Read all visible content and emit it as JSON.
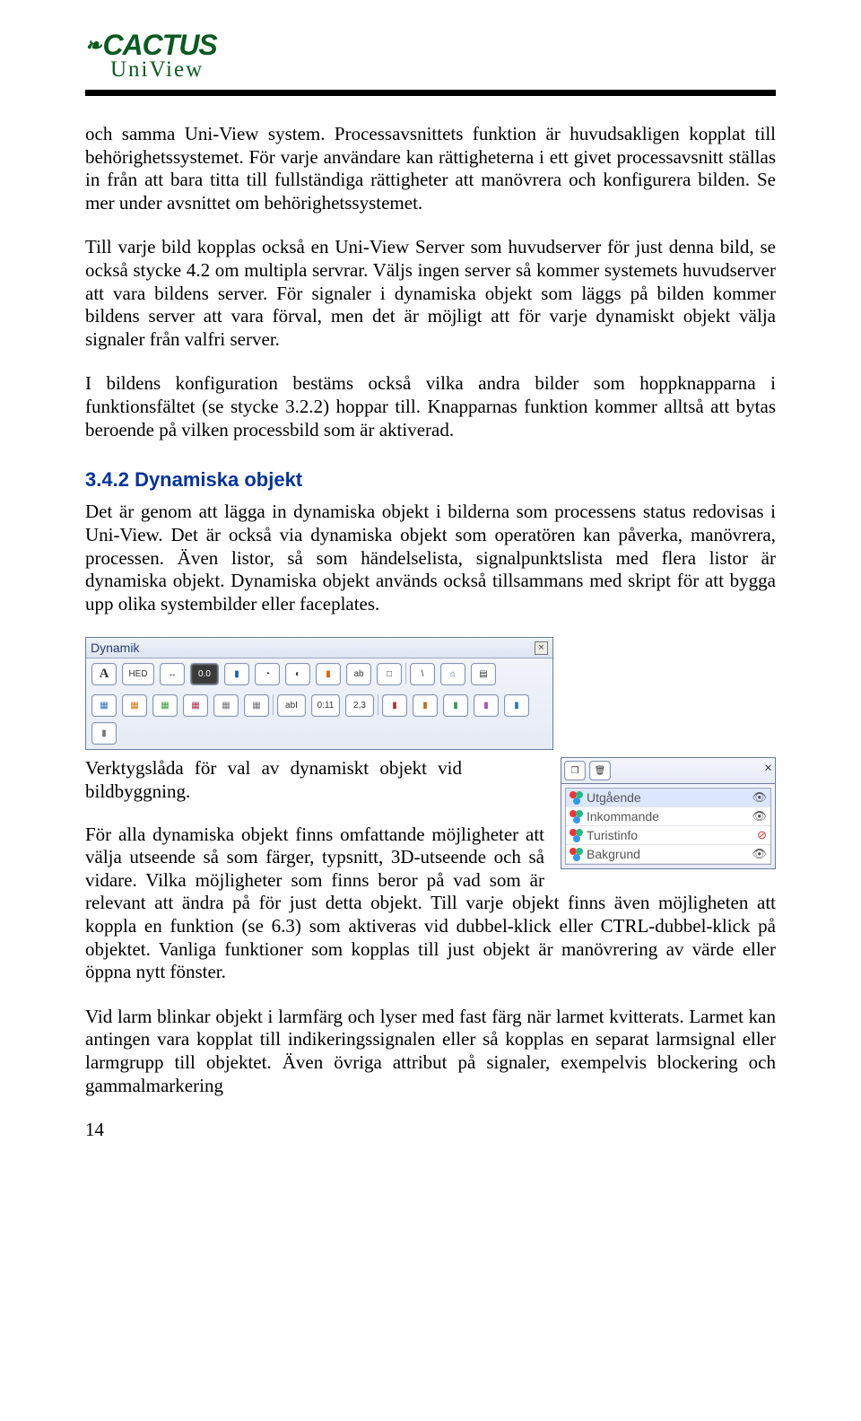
{
  "brand": {
    "line1": "CACTUS",
    "line2": "UniView"
  },
  "paragraphs": {
    "p1": "och samma Uni-View system. Processavsnittets funktion är huvudsakligen kopplat till behörighetssystemet. För varje användare kan rättigheterna i ett givet processavsnitt ställas in från att bara titta till fullständiga rättigheter att manövrera och konfigurera bilden. Se mer under avsnittet om behörighetssystemet.",
    "p2": "Till varje bild kopplas också en Uni-View Server som huvudserver för just denna bild, se också stycke 4.2 om multipla servrar. Väljs ingen server så kommer systemets huvudserver att vara bildens server. För signaler i dynamiska objekt som läggs på bilden kommer bildens server att vara förval, men det är möjligt att för varje dynamiskt objekt välja signaler från valfri server.",
    "p3": "I bildens konfiguration bestäms också vilka andra bilder som hoppknapparna i funktionsfältet (se stycke 3.2.2) hoppar till. Knapparnas funktion kommer alltså att bytas beroende på vilken processbild som är aktiverad.",
    "p4": "Det är genom att lägga in dynamiska objekt i bilderna som processens status redovisas i Uni-View. Det är också via dynamiska objekt som operatören kan påverka, manövrera, processen. Även listor, så som händelselista, signalpunktslista med flera listor är dynamiska objekt. Dynamiska objekt används också tillsammans med skript för att bygga upp olika systembilder eller faceplates.",
    "caption": "Verktygslåda för val av dynamiskt objekt vid bildbyggning.",
    "p5": "För alla dynamiska objekt finns omfattande möjligheter att välja utseende så som färger, typsnitt, 3D-utseende och så vidare. Vilka möjligheter som finns beror på vad som är relevant att ändra på för just detta objekt. Till varje objekt finns även möjligheten att koppla en funktion (se 6.3) som aktiveras vid dubbel-klick eller CTRL-dubbel-klick på objektet. Vanliga funktioner som kopplas till just objekt är manövrering av värde eller öppna nytt fönster.",
    "p6": "Vid larm blinkar objekt i larmfärg och lyser med fast färg när larmet kvitterats. Larmet kan antingen vara kopplat till indikeringssignalen eller så kopplas en separat larmsignal eller larmgrupp till objektet. Även övriga attribut på signaler, exempelvis blockering och gammalmarkering"
  },
  "section": {
    "num": "3.4.2",
    "title": "Dynamiska objekt"
  },
  "dynamik": {
    "title": "Dynamik",
    "row1": [
      "A",
      "HED",
      "↔",
      "0.0",
      "▮",
      "◔",
      "◐",
      "▮",
      "ab",
      "□",
      "\\",
      "⌂",
      "▤"
    ],
    "row2": [
      "▦",
      "▦",
      "▦",
      "▦",
      "▦",
      "▦",
      "abI",
      "0:11",
      "2,3",
      "▮",
      "▮",
      "▮",
      "▮",
      "▮",
      "▮"
    ]
  },
  "layers": {
    "items": [
      {
        "label": "Utgående",
        "visible": true,
        "selected": true
      },
      {
        "label": "Inkommande",
        "visible": true
      },
      {
        "label": "Turistinfo",
        "visible": false
      },
      {
        "label": "Bakgrund",
        "visible": true
      }
    ]
  },
  "page_number": "14"
}
